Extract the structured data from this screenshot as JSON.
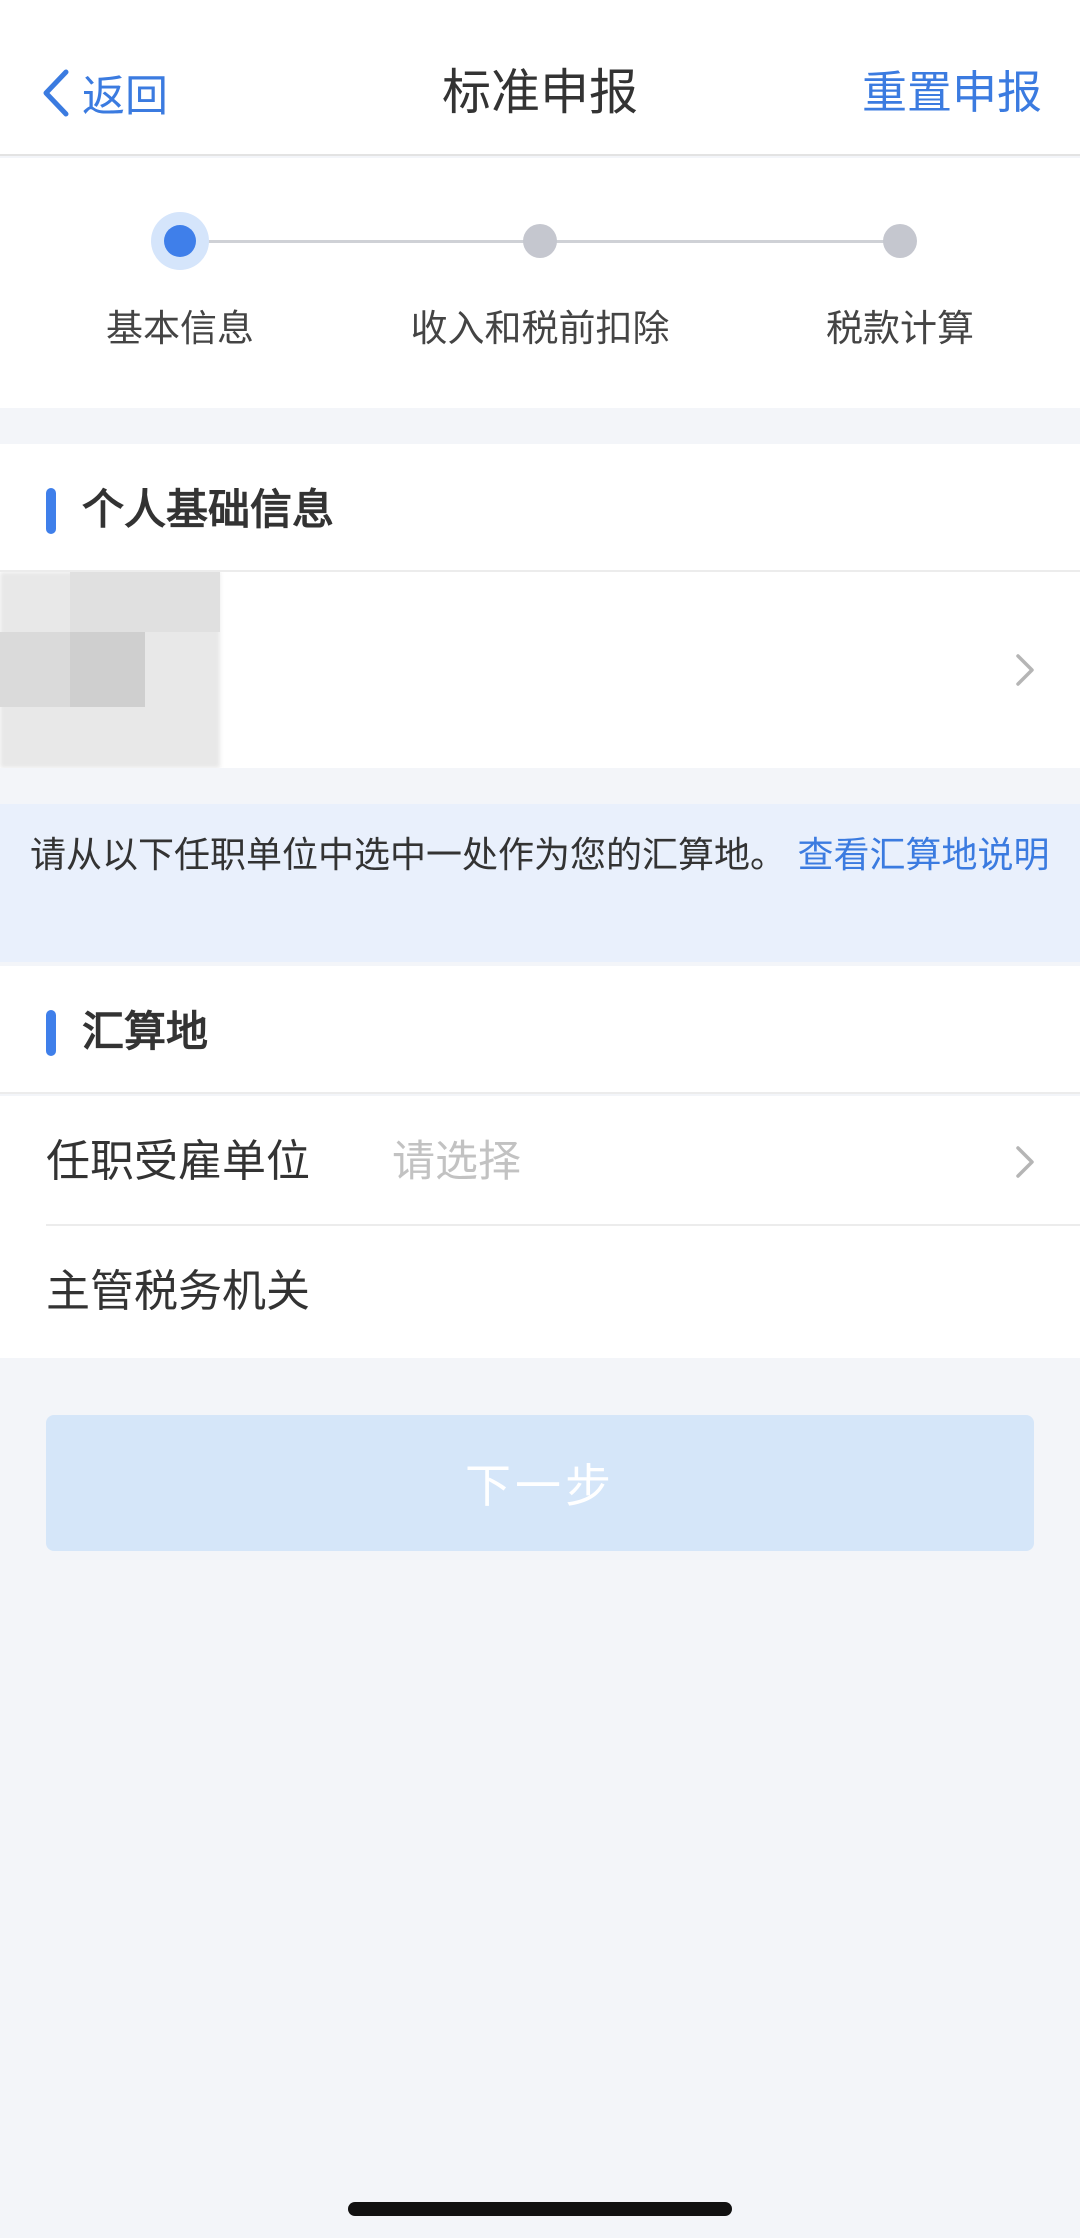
{
  "nav": {
    "back_label": "返回",
    "title": "标准申报",
    "reset_label": "重置申报"
  },
  "stepper": {
    "current": 1,
    "steps": [
      {
        "label": "基本信息"
      },
      {
        "label": "收入和税前扣除"
      },
      {
        "label": "税款计算"
      }
    ]
  },
  "personal_section": {
    "title": "个人基础信息"
  },
  "notice": {
    "text": "请从以下任职单位中选中一处作为您的汇算地。",
    "link": "查看汇算地说明"
  },
  "settlement_section": {
    "title": "汇算地",
    "employer_label": "任职受雇单位",
    "employer_placeholder": "请选择",
    "tax_office_label": "主管税务机关"
  },
  "next_button": {
    "label": "下一步"
  },
  "colors": {
    "accent": "#3f7fea",
    "link": "#3b7be0",
    "notice_bg": "#e9f0fc",
    "disabled_button": "#d5e6f9"
  }
}
